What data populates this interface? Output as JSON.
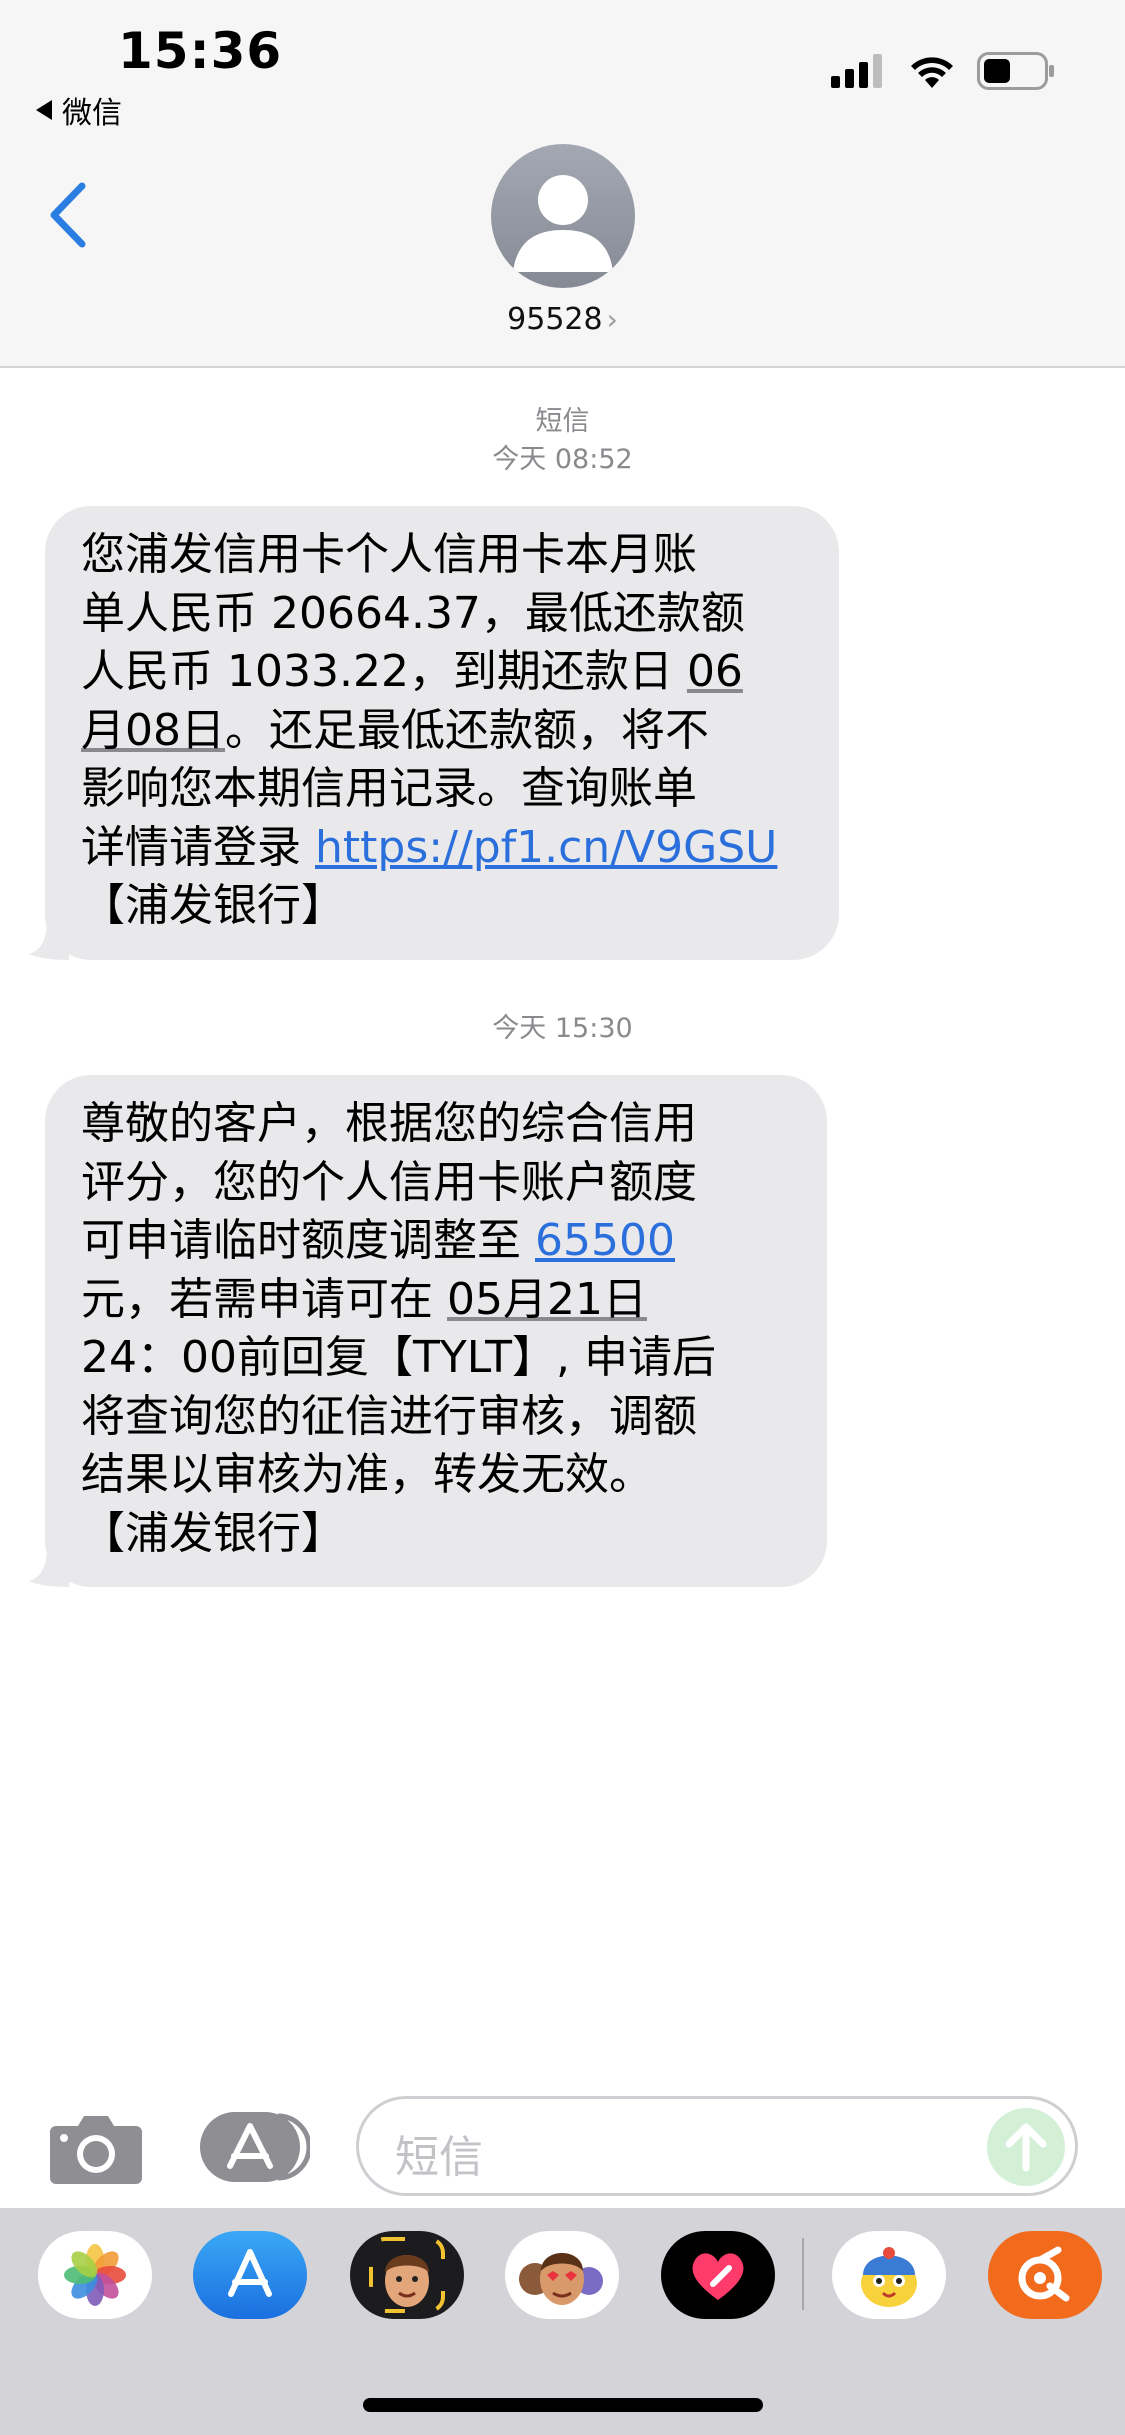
{
  "status_bar": {
    "time": "15:36",
    "back_app_label": "微信"
  },
  "header": {
    "contact_number": "95528",
    "contact_chevron": "›"
  },
  "messages": [
    {
      "service_label": "短信",
      "timestamp": "今天 08:52",
      "lines": [
        [
          "您浦发信用卡个人信用卡本月账"
        ],
        [
          "单人民币 20664.37，最低还款额"
        ],
        [
          "人民币 1033.22，到期还款日 ",
          "06"
        ],
        [
          "月08日",
          "。还足最低还款额，将不"
        ],
        [
          "影响您本期信用记录。查询账单"
        ],
        [
          "详情请登录 ",
          "https://pf1.cn/V9GSU"
        ],
        [
          "【浦发银行】"
        ]
      ]
    },
    {
      "timestamp": "今天 15:30",
      "lines": [
        [
          "尊敬的客户，根据您的综合信用"
        ],
        [
          "评分，您的个人信用卡账户额度"
        ],
        [
          "可申请临时额度调整至 ",
          "65500"
        ],
        [
          "元，若需申请可在 ",
          "05月21日"
        ],
        [
          "24：00前回复【TYLT】, 申请后"
        ],
        [
          "将查询您的征信进行审核，调额"
        ],
        [
          "结果以审核为准，转发无效。"
        ],
        [
          "【浦发银行】"
        ]
      ]
    }
  ],
  "composer": {
    "placeholder": "短信"
  },
  "app_drawer": {
    "icons": [
      "photos-icon",
      "app-store-icon",
      "memoji-icon",
      "animoji-icon",
      "digital-touch-icon",
      "sticker-app-icon",
      "orange-app-icon"
    ]
  },
  "colors": {
    "accent_blue": "#2a7de1",
    "bubble_gray": "#e9e9eb",
    "link_blue": "#2a6fdb"
  }
}
